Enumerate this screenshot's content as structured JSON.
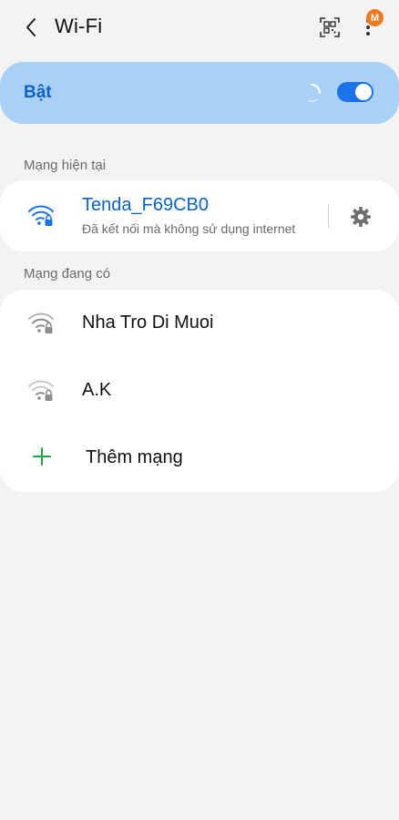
{
  "header": {
    "title": "Wi-Fi",
    "back_icon": "chevron-left-icon",
    "qr_icon": "qr-scan-icon",
    "more_icon": "more-vert-icon",
    "badge": "M"
  },
  "master_switch": {
    "label": "Bật",
    "state": "on",
    "accent": "#1a73e8",
    "background": "#a9d0f6",
    "label_color": "#0b62c7"
  },
  "current_network": {
    "section_label": "Mạng hiện tại",
    "name": "Tenda_F69CB0",
    "status": "Đã kết nối mà không sử dụng internet",
    "icon": "wifi-lock-icon",
    "settings_icon": "gear-icon",
    "name_color": "#0b62c7"
  },
  "available_networks": {
    "section_label": "Mạng đang có",
    "items": [
      {
        "name": "Nha Tro Di Muoi",
        "icon": "wifi-lock-icon"
      },
      {
        "name": "A.K",
        "icon": "wifi-lock-icon"
      }
    ],
    "add_label": "Thêm mạng",
    "add_icon": "plus-icon",
    "add_color": "#1ea446"
  }
}
